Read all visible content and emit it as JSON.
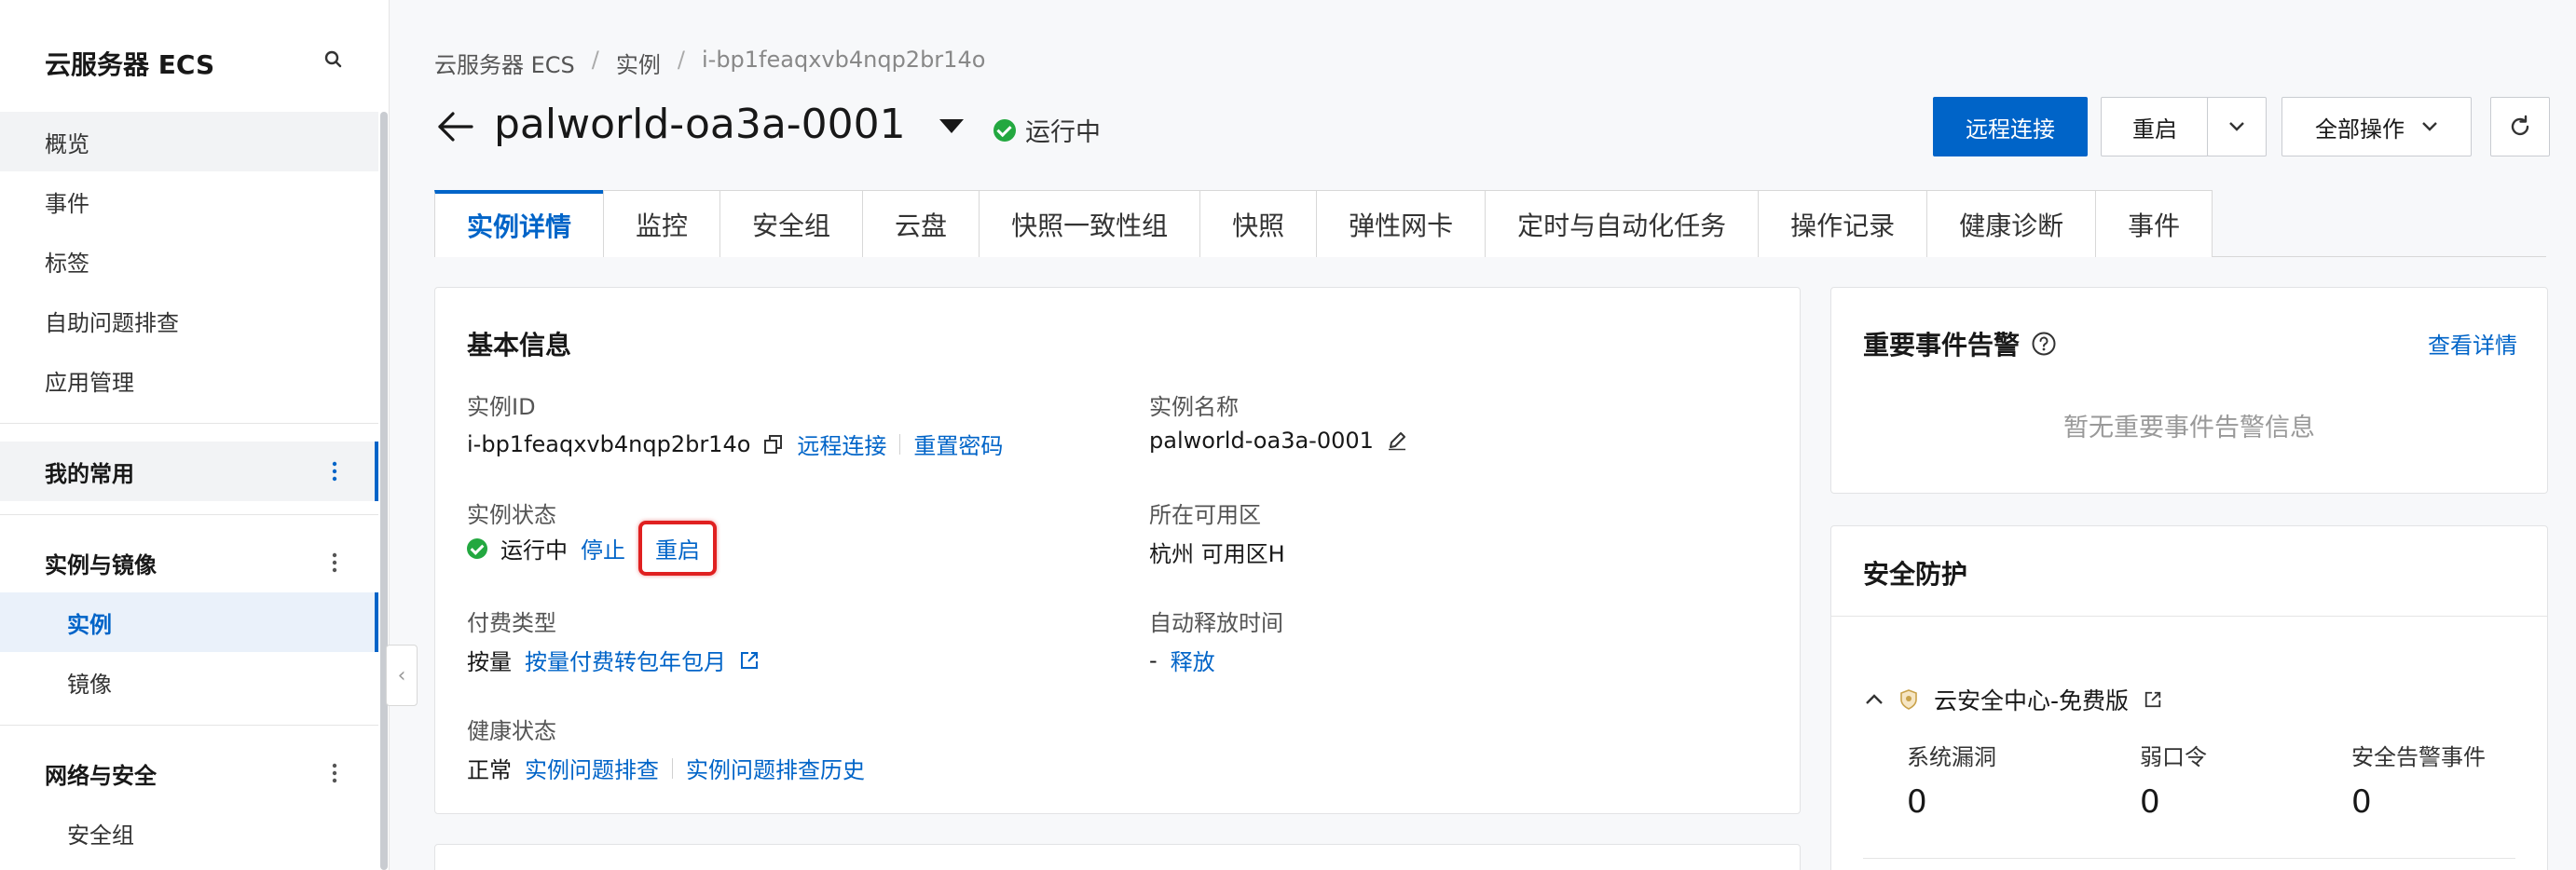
{
  "sidebar": {
    "title": "云服务器 ECS",
    "items": [
      {
        "label": "概览"
      },
      {
        "label": "事件"
      },
      {
        "label": "标签"
      },
      {
        "label": "自助问题排查"
      },
      {
        "label": "应用管理"
      },
      {
        "label": "我的常用"
      },
      {
        "label": "实例与镜像"
      },
      {
        "label": "实例"
      },
      {
        "label": "镜像"
      },
      {
        "label": "网络与安全"
      },
      {
        "label": "安全组"
      }
    ]
  },
  "breadcrumb": [
    "云服务器 ECS",
    "/",
    "实例",
    "/",
    "i-bp1feaqxvb4nqp2br14o"
  ],
  "header": {
    "title": "palworld-oa3a-0001",
    "status": "运行中",
    "buttons": {
      "remote": "远程连接",
      "restart": "重启",
      "all_ops": "全部操作"
    }
  },
  "tabs": [
    "实例详情",
    "监控",
    "安全组",
    "云盘",
    "快照一致性组",
    "快照",
    "弹性网卡",
    "定时与自动化任务",
    "操作记录",
    "健康诊断",
    "事件"
  ],
  "basic": {
    "title": "基本信息",
    "instance_id_label": "实例ID",
    "instance_id": "i-bp1feaqxvb4nqp2br14o",
    "remote_link": "远程连接",
    "reset_pwd": "重置密码",
    "instance_name_label": "实例名称",
    "instance_name": "palworld-oa3a-0001",
    "status_label": "实例状态",
    "status": "运行中",
    "stop": "停止",
    "restart": "重启",
    "zone_label": "所在可用区",
    "zone": "杭州 可用区H",
    "pay_label": "付费类型",
    "pay_value": "按量",
    "pay_link": "按量付费转包年包月",
    "release_label": "自动释放时间",
    "release_value": "-",
    "release_link": "释放",
    "health_label": "健康状态",
    "health_value": "正常",
    "health_link1": "实例问题排查",
    "health_link2": "实例问题排查历史"
  },
  "alerts": {
    "title": "重要事件告警",
    "details": "查看详情",
    "empty": "暂无重要事件告警信息"
  },
  "security": {
    "title": "安全防护",
    "center": "云安全中心-免费版",
    "stats": [
      {
        "label": "系统漏洞",
        "value": "0"
      },
      {
        "label": "弱口令",
        "value": "0"
      },
      {
        "label": "安全告警事件",
        "value": "0"
      }
    ]
  },
  "colors": {
    "accent": "#0064c8",
    "success": "#23a840",
    "highlight": "#e02020"
  }
}
